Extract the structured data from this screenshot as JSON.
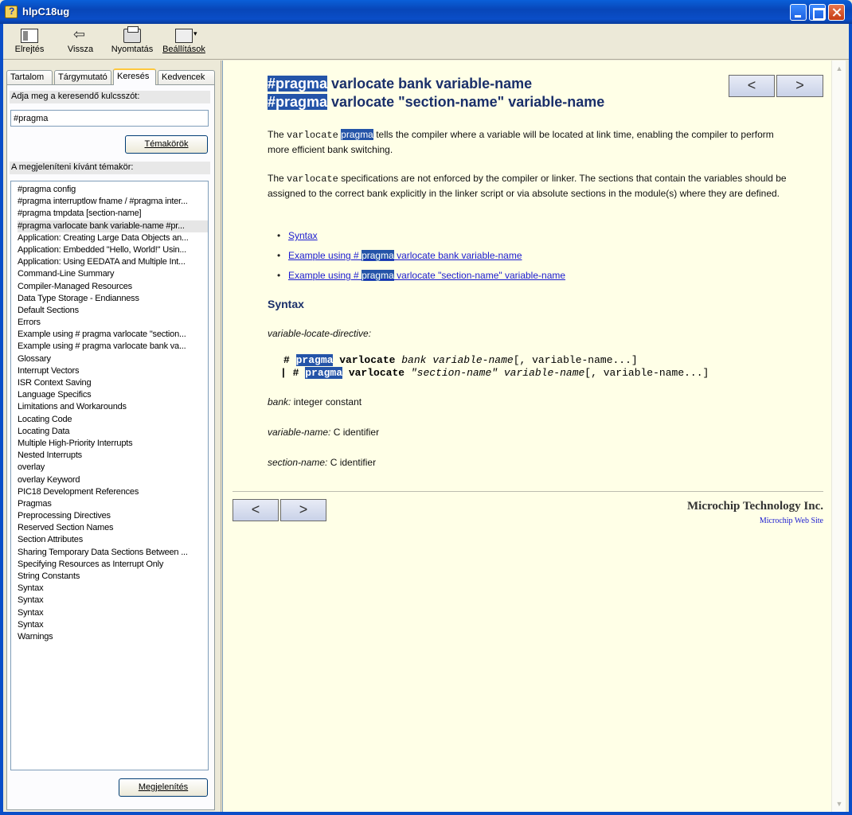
{
  "window": {
    "title": "hlpC18ug"
  },
  "toolbar": {
    "hide_label": "Elrejtés",
    "back_label": "Vissza",
    "print_label": "Nyomtatás",
    "options_label": "Beállítások"
  },
  "tabs": [
    "Tartalom",
    "Tárgymutató",
    "Keresés",
    "Kedvencek"
  ],
  "search": {
    "prompt": "Adja meg a keresendő kulcsszót:",
    "value": "#pragma",
    "topics_button": "Témakörök",
    "select_prompt": "A megjeleníteni kívánt témakör:",
    "display_button": "Megjelenítés",
    "results": [
      "#pragma config",
      "#pragma interruptlow fname / #pragma inter...",
      "#pragma tmpdata [section-name]",
      "#pragma varlocate bank variable-name #pr...",
      "Application: Creating Large Data Objects an...",
      "Application: Embedded \"Hello, World!\" Usin...",
      "Application: Using EEDATA and Multiple Int...",
      "Command-Line Summary",
      "Compiler-Managed Resources",
      "Data Type Storage - Endianness",
      "Default Sections",
      "Errors",
      "Example using # pragma varlocate \"section...",
      "Example using # pragma varlocate bank va...",
      "Glossary",
      "Interrupt Vectors",
      "ISR Context Saving",
      "Language Specifics",
      "Limitations and Workarounds",
      "Locating Code",
      "Locating Data",
      "Multiple High-Priority Interrupts",
      "Nested Interrupts",
      "overlay",
      "overlay Keyword",
      "PIC18 Development References",
      "Pragmas",
      "Preprocessing Directives",
      "Reserved Section Names",
      "Section Attributes",
      "Sharing Temporary Data Sections Between ...",
      "Specifying Resources as Interrupt Only",
      "String Constants",
      "Syntax",
      "Syntax",
      "Syntax",
      "Syntax",
      "Warnings"
    ]
  },
  "article": {
    "title_hl": "#pragma",
    "title_line1_rest": " varlocate bank variable-name",
    "title_line2_rest": " varlocate \"section-name\" variable-name",
    "prev": "<",
    "next": ">",
    "p1_a": "The ",
    "p1_code": "varlocate",
    "p1_hl": "pragma",
    "p1_b": " tells the compiler where a variable will be located at link time, enabling the compiler to perform more efficient bank switching.",
    "p2_a": "The ",
    "p2_code": "varlocate",
    "p2_b": " specifications are not enforced by the compiler or linker. The sections that contain the variables should be assigned to the correct bank explicitly in the linker script or via absolute sections in the module(s) where they are defined.",
    "links": {
      "syntax": "Syntax",
      "ex1_a": "Example using # ",
      "ex1_hl": "pragma",
      "ex1_b": " varlocate bank variable-name",
      "ex2_a": "Example using # ",
      "ex2_hl": "pragma",
      "ex2_b": " varlocate \"section-name\" variable-name"
    },
    "syntax_heading": "Syntax",
    "directive_label": "variable-locate-directive:",
    "code1": {
      "hash": "# ",
      "hl": "pragma",
      "kw": " varlocate ",
      "arg": "bank variable-name",
      "tail": "[, variable-name...]"
    },
    "code2": {
      "bar": "| # ",
      "hl": "pragma",
      "kw": " varlocate ",
      "arg": "\"section-name\" variable-name",
      "tail": "[, variable-name...]"
    },
    "defs": [
      {
        "term": "bank:",
        "desc": " integer constant"
      },
      {
        "term": "variable-name:",
        "desc": " C identifier"
      },
      {
        "term": "section-name:",
        "desc": " C identifier"
      }
    ],
    "company": "Microchip Technology Inc.",
    "website": "Microchip Web Site"
  }
}
